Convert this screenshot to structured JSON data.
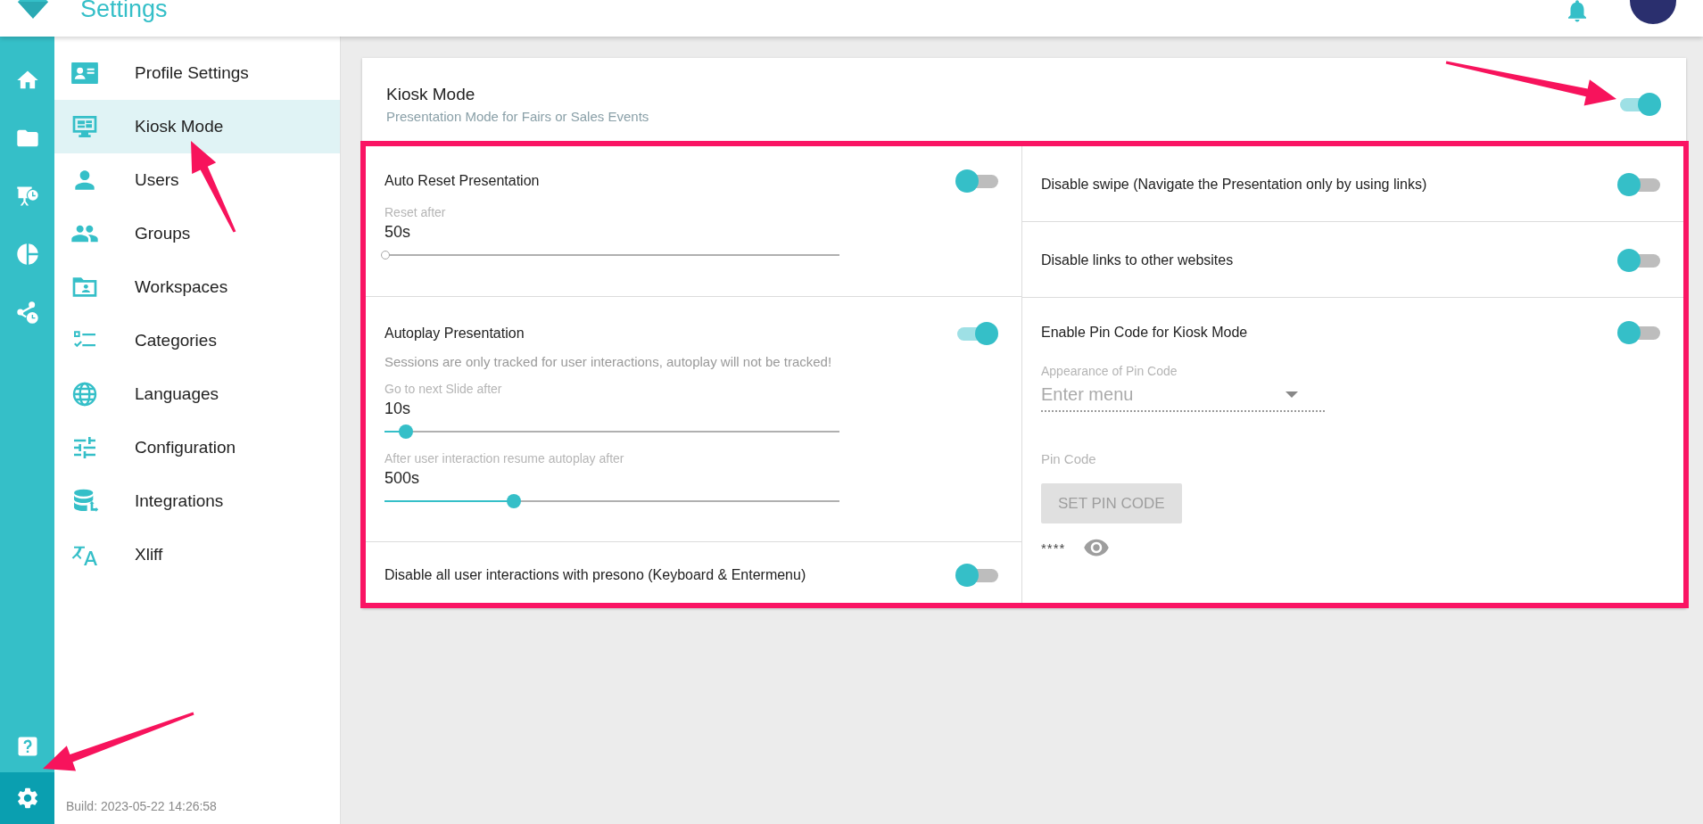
{
  "header": {
    "title": "Settings"
  },
  "rail": {
    "items": [
      {
        "selected": false
      },
      {
        "selected": false
      },
      {
        "selected": false
      },
      {
        "selected": false
      },
      {
        "selected": false
      }
    ],
    "bottom": [
      {
        "selected": false
      },
      {
        "selected": true
      }
    ]
  },
  "sidebar": {
    "items": [
      {
        "label": "Profile Settings",
        "selected": false
      },
      {
        "label": "Kiosk Mode",
        "selected": true
      },
      {
        "label": "Users",
        "selected": false
      },
      {
        "label": "Groups",
        "selected": false
      },
      {
        "label": "Workspaces",
        "selected": false
      },
      {
        "label": "Categories",
        "selected": false
      },
      {
        "label": "Languages",
        "selected": false
      },
      {
        "label": "Configuration",
        "selected": false
      },
      {
        "label": "Integrations",
        "selected": false
      },
      {
        "label": "Xliff",
        "selected": false
      }
    ],
    "build": "Build: 2023-05-22 14:26:58"
  },
  "card": {
    "title": "Kiosk Mode",
    "subtitle": "Presentation Mode for Fairs or Sales Events",
    "on": true,
    "left": [
      {
        "label": "Auto Reset Presentation",
        "on": false,
        "sliders": [
          {
            "label": "Reset after",
            "value": "50s",
            "level": 0
          }
        ]
      },
      {
        "label": "Autoplay Presentation",
        "on": true,
        "note": "Sessions are only tracked for user interactions, autoplay will not be tracked!",
        "sliders": [
          {
            "label": "Go to next Slide after",
            "value": "10s",
            "level": 0.045
          },
          {
            "label": "After user interaction resume autoplay after",
            "value": "500s",
            "level": 0.275
          }
        ]
      },
      {
        "label": "Disable all user interactions with presono (Keyboard & Entermenu)",
        "on": false
      }
    ],
    "right": [
      {
        "label": "Disable swipe (Navigate the Presentation only by using links)",
        "on": false
      },
      {
        "label": "Disable links to other websites",
        "on": false
      },
      {
        "label": "Enable Pin Code for Kiosk Mode",
        "on": false,
        "select": {
          "label": "Appearance of Pin Code",
          "placeholder": "Enter menu"
        },
        "pin_label": "Pin Code",
        "button": {
          "label": "SET PIN CODE",
          "disabled": true
        },
        "masked": "****"
      }
    ]
  }
}
